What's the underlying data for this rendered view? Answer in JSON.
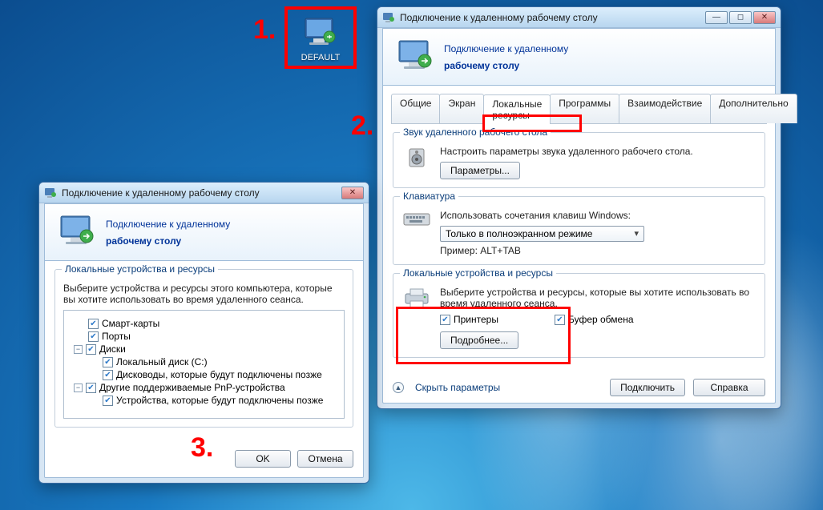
{
  "annotations": {
    "one": "1.",
    "two": "2.",
    "three": "3."
  },
  "desktop_icon": {
    "label": "DEFAULT"
  },
  "common": {
    "window_title": "Подключение к удаленному рабочему столу",
    "header_line1": "Подключение к удаленному",
    "header_line2": "рабочему столу"
  },
  "main_window": {
    "tabs": {
      "general": "Общие",
      "screen": "Экран",
      "local": "Локальные ресурсы",
      "programs": "Программы",
      "interaction": "Взаимодействие",
      "advanced": "Дополнительно"
    },
    "audio_group": {
      "legend": "Звук удаленного рабочего стола",
      "desc": "Настроить параметры звука удаленного рабочего стола.",
      "button": "Параметры..."
    },
    "keyboard_group": {
      "legend": "Клавиатура",
      "desc": "Использовать сочетания клавиш Windows:",
      "dropdown": "Только в полноэкранном режиме",
      "example": "Пример: ALT+TAB"
    },
    "devices_group": {
      "legend": "Локальные устройства и ресурсы",
      "desc": "Выберите устройства и ресурсы, которые вы хотите использовать во время удаленного сеанса.",
      "cb_printers": "Принтеры",
      "cb_clipboard": "Буфер обмена",
      "more_button": "Подробнее..."
    },
    "hide_params": "Скрыть параметры",
    "connect": "Подключить",
    "help": "Справка"
  },
  "small_window": {
    "group_legend": "Локальные устройства и ресурсы",
    "desc": "Выберите устройства и ресурсы этого компьютера, которые вы хотите использовать во время удаленного сеанса.",
    "tree": {
      "smartcards": "Смарт-карты",
      "ports": "Порты",
      "drives": "Диски",
      "local_c": "Локальный диск (C:)",
      "later_drives": "Дисководы, которые будут подключены позже",
      "other_pnp": "Другие поддерживаемые PnP-устройства",
      "later_devices": "Устройства, которые будут подключены позже"
    },
    "ok": "OK",
    "cancel": "Отмена"
  }
}
